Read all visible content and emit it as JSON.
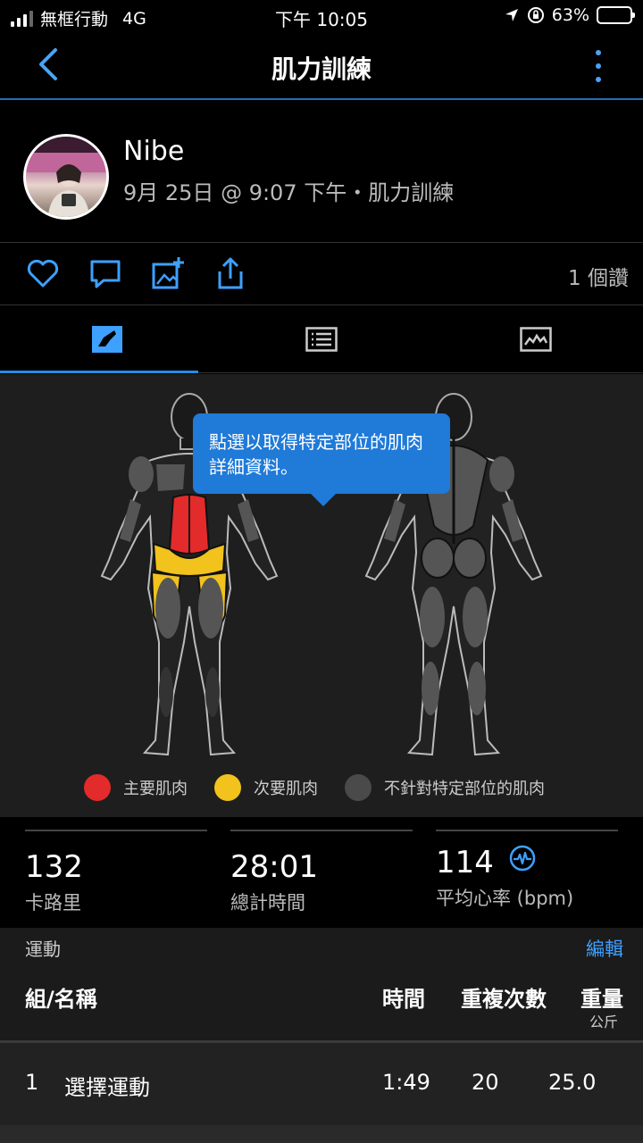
{
  "status": {
    "carrier": "無框行動",
    "network": "4G",
    "time": "下午 10:05",
    "battery": "63%"
  },
  "nav": {
    "title": "肌力訓練"
  },
  "profile": {
    "name": "Nibe",
    "subtitle": "9月 25日 @ 9:07 下午・肌力訓練"
  },
  "actions": {
    "likes": "1 個讚"
  },
  "muscle_map": {
    "tooltip": "點選以取得特定部位的肌肉詳細資料。",
    "legend": [
      {
        "label": "主要肌肉",
        "color": "#e32b2b"
      },
      {
        "label": "次要肌肉",
        "color": "#f2c21d"
      },
      {
        "label": "不針對特定部位的肌肉",
        "color": "#4a4a4a"
      }
    ]
  },
  "stats": [
    {
      "value": "132",
      "label": "卡路里"
    },
    {
      "value": "28:01",
      "label": "總計時間"
    },
    {
      "value": "114",
      "label": "平均心率 (bpm)"
    }
  ],
  "exercise": {
    "title": "運動",
    "edit_label": "編輯",
    "headers": {
      "set_name": "組/名稱",
      "time": "時間",
      "reps": "重複次數",
      "weight": "重量",
      "weight_unit": "公斤"
    },
    "rows": [
      {
        "set": "1",
        "name": "選擇運動",
        "time": "1:49",
        "reps": "20",
        "weight": "25.0"
      }
    ]
  },
  "colors": {
    "accent": "#1f7ad8",
    "primary_muscle": "#e32b2b",
    "secondary_muscle": "#f2c21d",
    "other_muscle": "#4a4a4a"
  }
}
